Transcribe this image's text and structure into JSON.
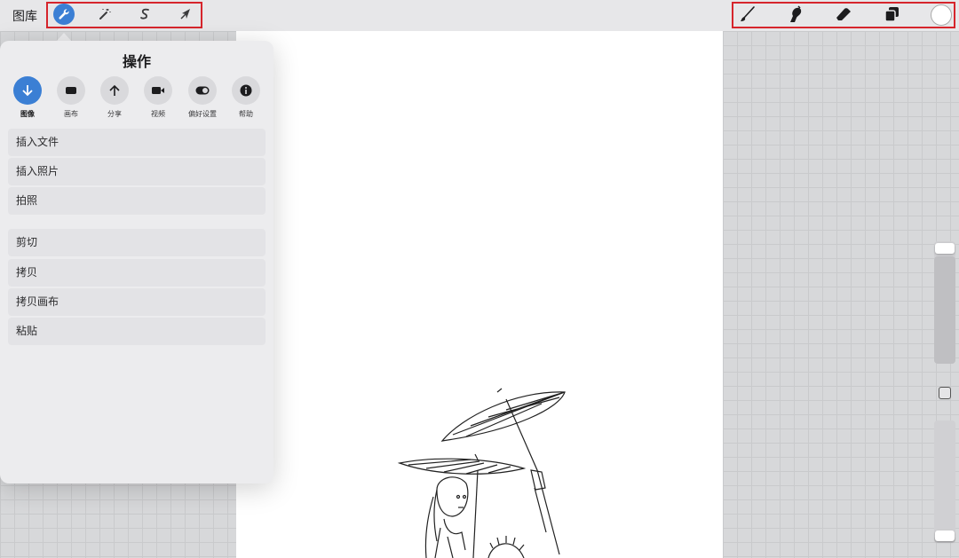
{
  "topbar": {
    "gallery_label": "图库",
    "left_tools": [
      {
        "name": "actions",
        "icon": "wrench-icon",
        "active": true
      },
      {
        "name": "adjustments",
        "icon": "magic-wand-icon",
        "active": false
      },
      {
        "name": "selection",
        "icon": "selection-s-icon",
        "active": false
      },
      {
        "name": "transform",
        "icon": "arrow-cursor-icon",
        "active": false
      }
    ],
    "right_tools": [
      {
        "name": "brush",
        "icon": "paintbrush-icon"
      },
      {
        "name": "smudge",
        "icon": "smudge-finger-icon"
      },
      {
        "name": "eraser",
        "icon": "eraser-icon"
      },
      {
        "name": "layers",
        "icon": "layers-icon"
      },
      {
        "name": "color",
        "icon": "color-circle-icon"
      }
    ],
    "active_color": "#ffffff",
    "highlight_color": "#d6252c"
  },
  "popover": {
    "title": "操作",
    "tabs": [
      {
        "label": "图像",
        "icon": "arrow-down-icon",
        "active": true
      },
      {
        "label": "画布",
        "icon": "canvas-rect-icon",
        "active": false
      },
      {
        "label": "分享",
        "icon": "arrow-up-icon",
        "active": false
      },
      {
        "label": "视频",
        "icon": "video-camera-icon",
        "active": false
      },
      {
        "label": "偏好设置",
        "icon": "toggle-icon",
        "active": false
      },
      {
        "label": "帮助",
        "icon": "info-icon",
        "active": false
      }
    ],
    "group1": [
      "插入文件",
      "插入照片",
      "拍照"
    ],
    "group2": [
      "剪切",
      "拷贝",
      "拷贝画布",
      "粘贴"
    ],
    "accent_color": "#3b7fd4"
  },
  "sidebar": {
    "brush_size_level": 0.88,
    "opacity_level": 0.06
  }
}
